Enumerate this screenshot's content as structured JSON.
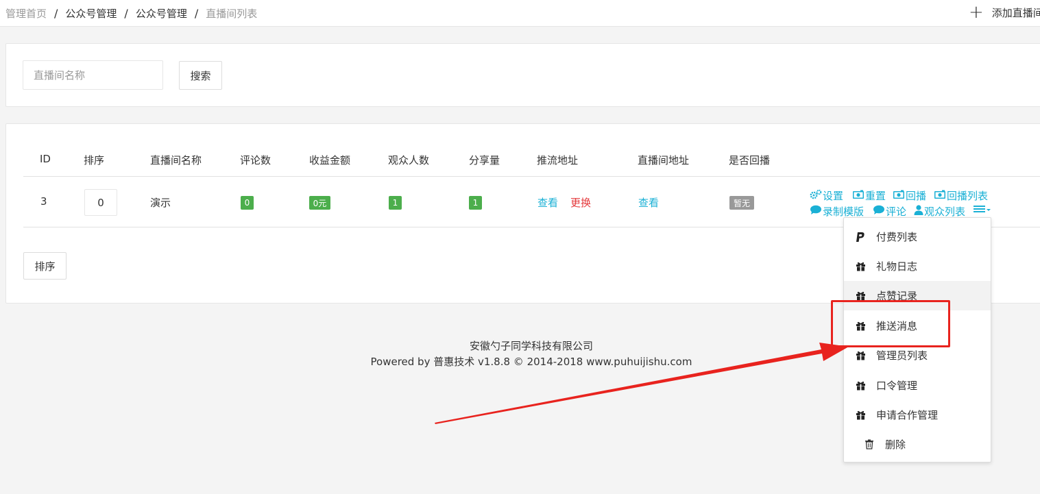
{
  "breadcrumb": [
    {
      "label": "管理首页"
    },
    {
      "label": "公众号管理"
    },
    {
      "label": "公众号管理"
    },
    {
      "label": "直播间列表"
    }
  ],
  "breadcrumb_separator": "/",
  "topbar": {
    "add_label": "添加直播间"
  },
  "search": {
    "placeholder": "直播间名称",
    "button_label": "搜索"
  },
  "table": {
    "headers": [
      "ID",
      "排序",
      "直播间名称",
      "评论数",
      "收益金额",
      "观众人数",
      "分享量",
      "推流地址",
      "直播间地址",
      "是否回播"
    ],
    "row": {
      "id": "3",
      "sort": "0",
      "name": "演示",
      "comments": "0",
      "revenue": "0元",
      "viewers": "1",
      "shares": "1",
      "push_view": "查看",
      "push_change": "更换",
      "room_view": "查看",
      "replay": "暂无"
    },
    "ops": {
      "settings": "设置",
      "reset": "重置",
      "replay": "回播",
      "replay_list": "回播列表",
      "record_template": "录制模版",
      "comment": "评论",
      "audience_list": "观众列表"
    },
    "sort_button": "排序"
  },
  "dropdown": {
    "items": [
      {
        "label": "付费列表",
        "icon": "paypal-icon"
      },
      {
        "label": "礼物日志",
        "icon": "gift-icon"
      },
      {
        "label": "点赞记录",
        "icon": "gift-icon"
      },
      {
        "label": "推送消息",
        "icon": "gift-icon"
      },
      {
        "label": "管理员列表",
        "icon": "gift-icon"
      },
      {
        "label": "口令管理",
        "icon": "gift-icon"
      },
      {
        "label": "申请合作管理",
        "icon": "gift-icon"
      },
      {
        "label": "删除",
        "icon": "trash-icon"
      }
    ],
    "hovered": "点赞记录"
  },
  "footer": {
    "company": "安徽勺子同学科技有限公司",
    "powered": "Powered by 普惠技术 v1.8.8 © 2014-2018 www.puhuijishu.com"
  },
  "colors": {
    "link": "#1ab0d5",
    "danger": "#e4393c",
    "badge_green": "#4cae4c",
    "badge_gray": "#999999",
    "annotation_red": "#e8231e"
  }
}
